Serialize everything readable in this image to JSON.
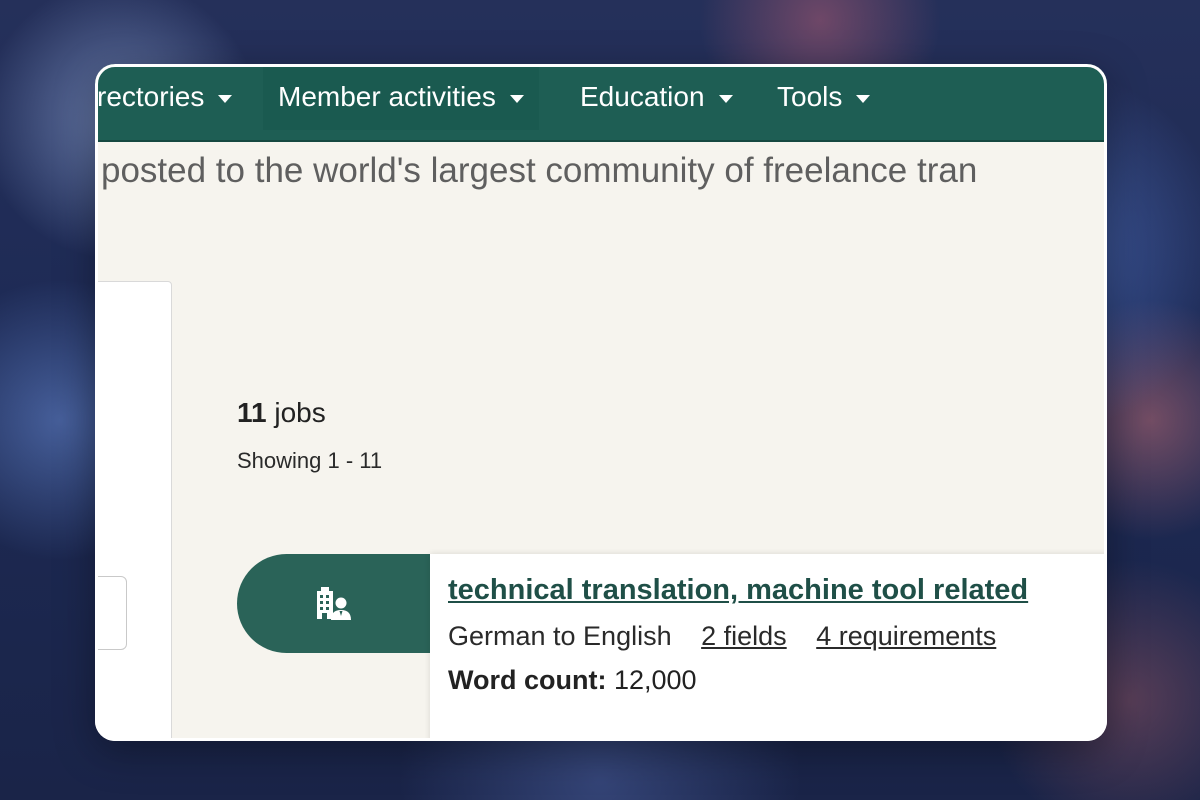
{
  "nav": {
    "items": [
      {
        "label": "rectories"
      },
      {
        "label": "Member activities"
      },
      {
        "label": "Education"
      },
      {
        "label": "Tools"
      }
    ]
  },
  "tagline": "posted to the world's largest community of freelance tran",
  "results": {
    "count": "11",
    "count_suffix": "jobs",
    "showing": "Showing 1 - 11"
  },
  "job": {
    "icon": "building-person-icon",
    "title": "technical translation, machine tool related",
    "language_pair": "German to English",
    "fields_link": "2 fields",
    "requirements_link": "4 requirements",
    "word_count_label": "Word count:",
    "word_count_value": "12,000"
  },
  "colors": {
    "nav_bg": "#1e5e54",
    "accent": "#2a6358",
    "title_link": "#1f4f47",
    "page_bg": "#f6f4ee"
  }
}
